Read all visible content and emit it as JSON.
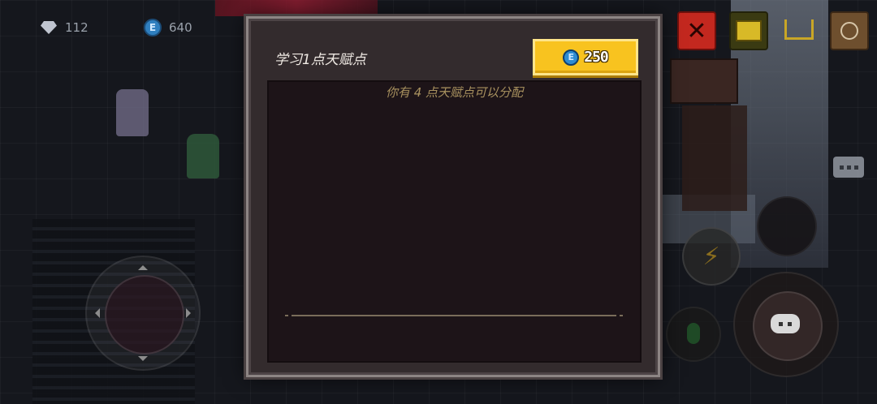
{
  "hud": {
    "gems": "112",
    "coins": "640",
    "coin_glyph": "E",
    "top_icons": [
      "close-icon",
      "chest-icon",
      "cart-icon",
      "book-clock-icon"
    ],
    "close_glyph": "✕"
  },
  "dialog": {
    "title": "学习1点天赋点",
    "cost": "250",
    "cost_coin_glyph": "E",
    "info": "你有 4 点天赋点可以分配"
  },
  "colors": {
    "accent_gold": "#f8c31f",
    "coin_blue": "#2e8cd2",
    "close_red": "#c3281f",
    "info_text": "#a9925f"
  }
}
